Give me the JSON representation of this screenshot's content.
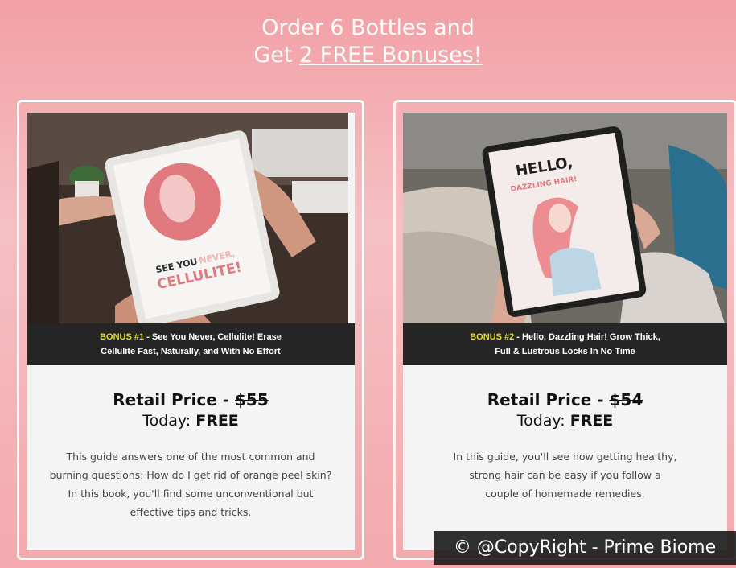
{
  "headline": {
    "line1": "Order 6 Bottles and",
    "line2_prefix": "Get ",
    "line2_link": "2 FREE Bonuses!"
  },
  "cards": [
    {
      "image_text_1": "SEE YOU",
      "image_text_2": "NEVER,",
      "image_text_3": "CELLULITE!",
      "bonus_tag": "BONUS #1",
      "caption_line1": " - See You Never, Cellulite! Erase",
      "caption_line2": "Cellulite Fast, Naturally, and With No Effort",
      "retail_prefix": "Retail Price - ",
      "retail_value": "$55",
      "today_prefix": "Today: ",
      "today_value": "FREE",
      "description": "This guide answers one of the most common and burning questions: How do I get rid of orange peel skin? In this book, you'll find some unconventional but effective tips and tricks."
    },
    {
      "image_text_1": "HELLO,",
      "image_text_2": "DAZZLING HAIR!",
      "bonus_tag": "BONUS #2",
      "caption_line1": " - Hello, Dazzling Hair! Grow Thick,",
      "caption_line2": "Full & Lustrous Locks In No Time",
      "retail_prefix": "Retail Price - ",
      "retail_value": "$54",
      "today_prefix": "Today: ",
      "today_value": "FREE",
      "description": "In this guide, you'll see how getting healthy, strong hair can be easy if you follow a couple of homemade remedies."
    }
  ],
  "watermark": "© @CopyRight - Prime Biome",
  "colors": {
    "background": "#f2a0a5",
    "caption_bg": "#262626",
    "bonus_tag": "#e6df1c"
  }
}
